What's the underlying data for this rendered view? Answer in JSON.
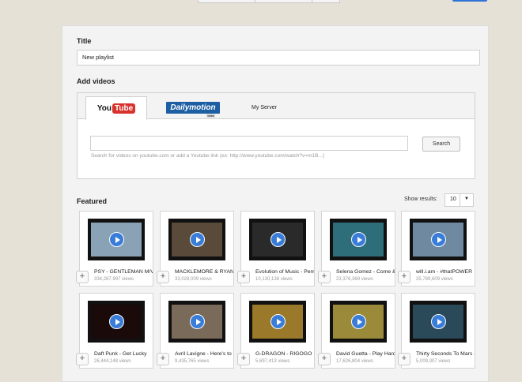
{
  "form": {
    "title_label": "Title",
    "title_value": "New playlist",
    "add_videos_label": "Add videos"
  },
  "sources": {
    "tabs": [
      {
        "label": "YouTube",
        "logo_you": "You",
        "logo_tube": "Tube",
        "active": true
      },
      {
        "label": "Dailymotion",
        "logo_main": "Dailymotion",
        "logo_beta": "beta",
        "active": false
      },
      {
        "label": "My Server",
        "active": false
      }
    ],
    "search_placeholder": "",
    "search_button": "Search",
    "hint": "Search for videos on youtube.com or add a Youtube link (ex: http://www.youtube.com/watch?v=m1B...)"
  },
  "featured": {
    "heading": "Featured",
    "show_results_label": "Show results:",
    "show_results_value": "10",
    "videos": [
      {
        "title": "PSY - GENTLEMAN M/V",
        "views": "334,287,997 views",
        "scene": "#8aa2b5"
      },
      {
        "title": "MACKLEMORE & RYAN",
        "views": "33,028,009 views",
        "scene": "#5a4a3a"
      },
      {
        "title": "Evolution of Music - Pentatonix",
        "views": "10,130,138 views",
        "scene": "#2a2a2a"
      },
      {
        "title": "Selena Gomez - Come & Get It",
        "views": "23,376,369 views",
        "scene": "#2e6e7a"
      },
      {
        "title": "will.i.am - #thatPOWER",
        "views": "25,789,609 views",
        "scene": "#6f8aa0"
      },
      {
        "title": "Daft Punk - Get Lucky",
        "views": "26,444,148 views",
        "scene": "#1a0a0a"
      },
      {
        "title": "Avril Lavigne - Here's to Never Growing Up",
        "views": "9,435,765 views",
        "scene": "#7a6a5a"
      },
      {
        "title": "G-DRAGON - ­­­­­­­­RIGOGO",
        "views": "5,697,413 views",
        "scene": "#9a7a2a"
      },
      {
        "title": "David Guetta - Play Hard",
        "views": "17,626,804 views",
        "scene": "#9a8a3a"
      },
      {
        "title": "Thirty Seconds To Mars - Up in the Air",
        "views": "5,009,307 views",
        "scene": "#2a4a5a"
      }
    ]
  },
  "colors": {
    "background": "#e6e1d6",
    "play_button": "#3a7dd8",
    "youtube_red": "#d8322c",
    "dailymotion_blue": "#1d5fa3"
  }
}
